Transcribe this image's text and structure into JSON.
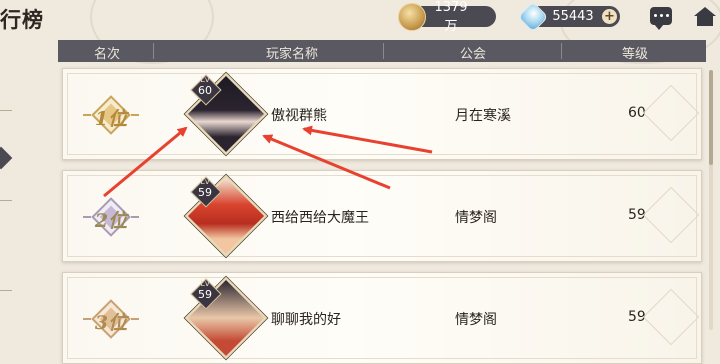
{
  "page": {
    "title": "行榜"
  },
  "resources": {
    "coins": "1379万",
    "gems": "55443",
    "plus_label": "+"
  },
  "table": {
    "headers": {
      "rank": "名次",
      "player": "玩家名称",
      "guild": "公会",
      "level": "等级"
    },
    "rows": [
      {
        "rank": "1位",
        "lv_label": "Lv",
        "lv": "60",
        "name": "傲视群熊",
        "guild": "月在寒溪",
        "level": "60"
      },
      {
        "rank": "2位",
        "lv_label": "Lv",
        "lv": "59",
        "name": "西给西给大魔王",
        "guild": "情梦阁",
        "level": "59"
      },
      {
        "rank": "3位",
        "lv_label": "Lv",
        "lv": "59",
        "name": "聊聊我的好",
        "guild": "情梦阁",
        "level": "59"
      }
    ]
  },
  "colors": {
    "annotation_arrow": "#e8412f",
    "header_bg": "#5a5962"
  }
}
